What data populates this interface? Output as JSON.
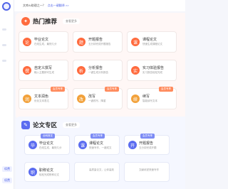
{
  "topnote": {
    "text": "文库AI助理之一？",
    "link": "点击一键翻译 >>"
  },
  "sidebar": {
    "btn1": "续费",
    "btn2": "续费"
  },
  "hot": {
    "title": "热门推荐",
    "more": "查看更多",
    "cards": [
      {
        "title": "毕业论文",
        "desc": "在线生成，最快几分",
        "icon": "论",
        "tag": ""
      },
      {
        "title": "开题报告",
        "desc": "五分钟完成开题报告",
        "icon": "题",
        "tag": ""
      },
      {
        "title": "课程论文",
        "desc": "快速生成课程论文",
        "icon": "课",
        "tag": ""
      },
      {
        "title": "自定义撰写",
        "desc": "输入主题即可生成",
        "icon": "撰",
        "tag": ""
      },
      {
        "title": "分析报告",
        "desc": "一键生成分析报告",
        "icon": "析",
        "tag": ""
      },
      {
        "title": "实习体验报告",
        "desc": "实习报告轻松完成",
        "icon": "实",
        "tag": ""
      },
      {
        "title": "文本润色",
        "desc": "优化文本表达",
        "icon": "润",
        "tag": "会员专享"
      },
      {
        "title": "改写",
        "desc": "一键改写，降重",
        "icon": "改",
        "tag": "会员专享"
      },
      {
        "title": "续写",
        "desc": "智能续写文本",
        "icon": "续",
        "tag": "会员专享"
      }
    ]
  },
  "thesis": {
    "title": "论文专区",
    "more": "查看更多",
    "cards": [
      {
        "title": "毕业论文",
        "desc": "在线生成，最快几分",
        "icon": "毕",
        "tag": "全网首发"
      },
      {
        "title": "课程论文",
        "desc": "快速写作，一键成文",
        "icon": "课",
        "tag": "会员专享"
      },
      {
        "title": "开题报告",
        "desc": "五分钟完成开题",
        "icon": "开",
        "tag": "会员专享"
      },
      {
        "title": "职称论文",
        "desc": "轻松完成职称论文",
        "icon": "职",
        "tag": ""
      },
      {
        "title": "",
        "desc": "高质量论文，让你高效",
        "icon": "",
        "tag": ""
      },
      {
        "title": "",
        "desc": "文献综述快速写作",
        "icon": "",
        "tag": ""
      }
    ]
  }
}
